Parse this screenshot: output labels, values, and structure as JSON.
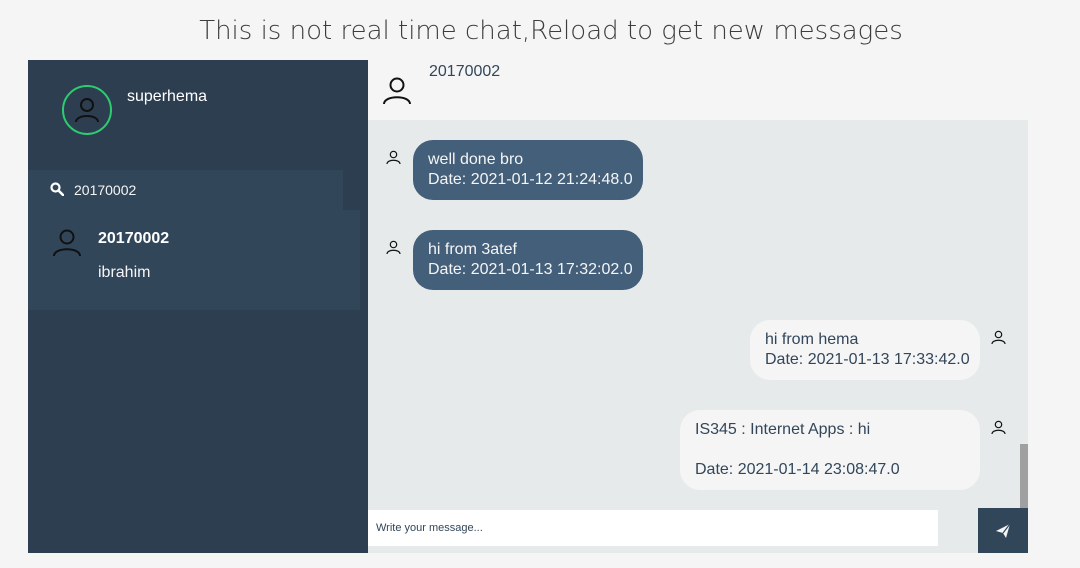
{
  "banner": {
    "text": "This is not real time chat,Reload to get new messages"
  },
  "sidebar": {
    "profile": {
      "username": "superhema",
      "avatar_icon": "user-icon",
      "status_color": "#2ecc71"
    },
    "search": {
      "value": "20170002",
      "icon": "search-icon"
    },
    "contacts": [
      {
        "name": "20170002",
        "preview": "ibrahim",
        "icon": "user-icon"
      }
    ]
  },
  "conversation": {
    "header": {
      "name": "20170002",
      "icon": "user-icon"
    },
    "messages": [
      {
        "direction": "received",
        "text": "well done bro",
        "date": "Date: 2021-01-12 21:24:48.0"
      },
      {
        "direction": "received",
        "text": "hi from 3atef",
        "date": "Date: 2021-01-13 17:32:02.0"
      },
      {
        "direction": "sent",
        "text": "hi from hema",
        "date": "Date: 2021-01-13 17:33:42.0"
      },
      {
        "direction": "sent",
        "text": "IS345 : Internet Apps :  hi",
        "date": "Date: 2021-01-14 23:08:47.0"
      }
    ],
    "composer": {
      "placeholder": "Write your message...",
      "send_icon": "send-icon"
    }
  },
  "colors": {
    "sidebar_bg": "#2c3e50",
    "received_bubble": "#435f7a",
    "sent_bubble": "#f5f5f5",
    "online_ring": "#2ecc71"
  }
}
